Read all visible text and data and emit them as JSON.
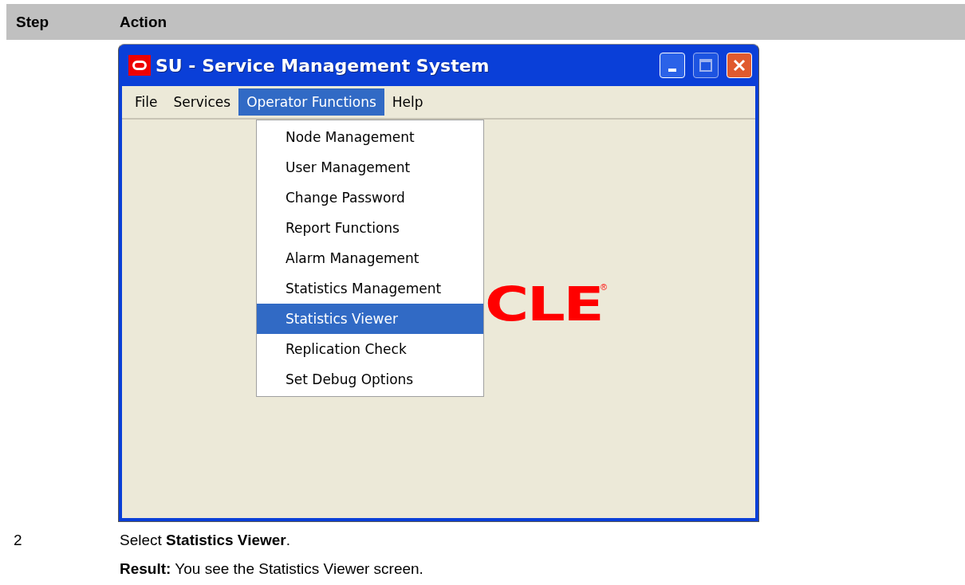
{
  "table": {
    "columns": [
      "Step",
      "Action"
    ]
  },
  "window": {
    "title": "SU - Service Management System",
    "menu_bar": [
      {
        "label": "File",
        "selected": false
      },
      {
        "label": "Services",
        "selected": false
      },
      {
        "label": "Operator Functions",
        "selected": true
      },
      {
        "label": "Help",
        "selected": false
      }
    ],
    "dropdown": [
      {
        "label": "Node Management",
        "selected": false
      },
      {
        "label": "User Management",
        "selected": false
      },
      {
        "label": "Change Password",
        "selected": false
      },
      {
        "label": "Report Functions",
        "selected": false
      },
      {
        "label": "Alarm Management",
        "selected": false
      },
      {
        "label": "Statistics Management",
        "selected": false
      },
      {
        "label": "Statistics Viewer",
        "selected": true
      },
      {
        "label": "Replication Check",
        "selected": false
      },
      {
        "label": "Set Debug Options",
        "selected": false
      }
    ],
    "logo_text": "CLE",
    "logo_mark": "®"
  },
  "step": {
    "number": "2",
    "instruction": "Select **Statistics Viewer**.",
    "result": "**Result:** You see the Statistics Viewer screen."
  }
}
